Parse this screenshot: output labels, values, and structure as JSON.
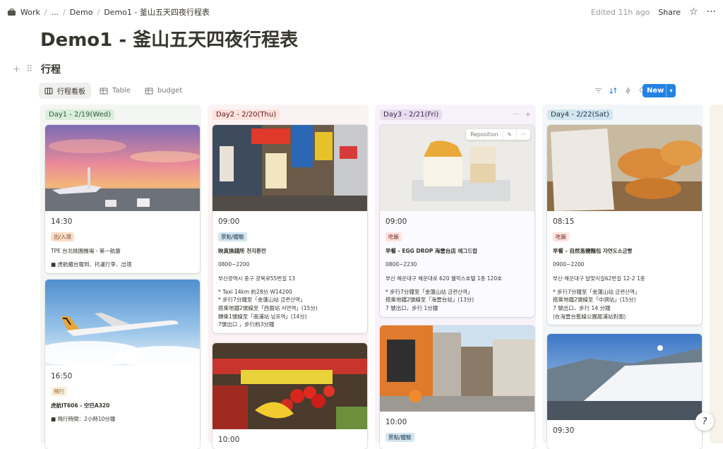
{
  "breadcrumb": {
    "workspace": "Work",
    "ellipsis": "...",
    "parent": "Demo",
    "current": "Demo1 - 釜山五天四夜行程表"
  },
  "topbar": {
    "edited": "Edited 11h ago",
    "share": "Share"
  },
  "page": {
    "title": "Demo1 - 釜山五天四夜行程表"
  },
  "database": {
    "title": "行程"
  },
  "views": [
    {
      "label": "行程看板",
      "icon": "board-icon"
    },
    {
      "label": "Table",
      "icon": "table-icon"
    },
    {
      "label": "budget",
      "icon": "table-icon"
    }
  ],
  "toolbar": {
    "new_label": "New"
  },
  "colors": {
    "accent": "#2383e2"
  },
  "columns": [
    {
      "label": "Day1 - 2/19(Wed)",
      "cards": [
        {
          "time": "14:30",
          "tag": "出/入境",
          "name": "TPE 台北桃園機場 - 第一航廈",
          "note": "■ 虎航櫃台報到、托運行李、出境"
        },
        {
          "time": "16:50",
          "tag": "飛行",
          "name": "虎航IT606 - 空巴A320",
          "note": "■ 飛行時間：2小時10分鐘"
        }
      ]
    },
    {
      "label": "Day2 - 2/20(Thu)",
      "cards": [
        {
          "time": "09:00",
          "tag": "景點/體驗",
          "name": "映真換錢所 천지환전",
          "hours": "0800~2200",
          "address": "부산광역시 중구 광복로55번길 13",
          "note": "* Taxi 14km 約28分 W14200\n* 步行7分鐘至「金蓮山站 금련산역」\n  搭乘地鐵2號線至「西面站 서면역」(15分)\n  轉乘1號線至「南浦站 남포역」(14分)\n  7號出口 ，步行約3分鐘"
        },
        {
          "time": "10:00",
          "tag": "",
          "name": ""
        }
      ]
    },
    {
      "label": "Day3 - 2/21(Fri)",
      "cards": [
        {
          "time": "09:00",
          "tag": "吃飯",
          "name": "早餐 - EGG DROP 海雲台店 에그드랍",
          "hours": "0800~2230",
          "address": "부산 해운대구 해운대로 620 웰릭스호텔 1층 120호",
          "note": "* 步行7分鐘至「金蓮山站 금련산역」\n  搭乘地鐵2號線至「海雲台站」(13分)\n  7 號出口，步行 1分鐘",
          "reposition": "Reposition"
        },
        {
          "time": "10:00",
          "tag": "景點/體驗",
          "name": ""
        }
      ]
    },
    {
      "label": "Day4 - 2/22(Sat)",
      "cards": [
        {
          "time": "08:15",
          "tag": "吃飯",
          "name": "早餐 - 自然島鹽麵包 자연도소금빵",
          "hours": "0900~2200",
          "address": "부산 해운대구 달맞이길62번길 12-2 1층",
          "note": "* 步行7分鐘至「金蓮山站 금련산역」\n  搭乘地鐵2號線至「中洞站」(15分)\n  7 號出口，步行 14 分鐘\n  (在海雲台藍線公園尾浦站對面)"
        },
        {
          "time": "09:30",
          "tag": "",
          "name": ""
        }
      ]
    }
  ]
}
